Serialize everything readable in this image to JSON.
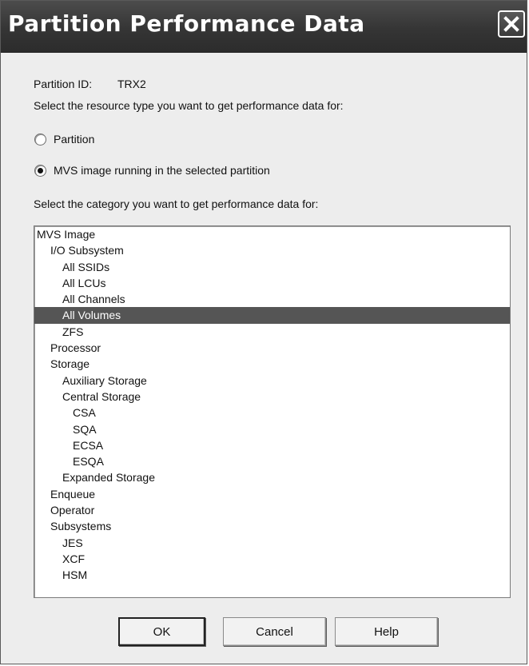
{
  "window": {
    "title": "Partition Performance Data",
    "close_icon": "close-icon"
  },
  "partition": {
    "label": "Partition ID:",
    "value": "TRX2"
  },
  "resource_prompt": "Select the resource type you want to get performance data for:",
  "resource_options": [
    {
      "label": "Partition",
      "checked": false
    },
    {
      "label": "MVS image running in the selected partition",
      "checked": true
    }
  ],
  "category_prompt": "Select the category you want to get performance data for:",
  "tree": {
    "items": [
      {
        "label": "MVS Image",
        "level": 0,
        "selected": false
      },
      {
        "label": "I/O Subsystem",
        "level": 1,
        "selected": false
      },
      {
        "label": "All SSIDs",
        "level": 2,
        "selected": false
      },
      {
        "label": "All LCUs",
        "level": 2,
        "selected": false
      },
      {
        "label": "All Channels",
        "level": 2,
        "selected": false
      },
      {
        "label": "All Volumes",
        "level": 2,
        "selected": true
      },
      {
        "label": "ZFS",
        "level": 2,
        "selected": false
      },
      {
        "label": "Processor",
        "level": 1,
        "selected": false
      },
      {
        "label": "Storage",
        "level": 1,
        "selected": false
      },
      {
        "label": "Auxiliary Storage",
        "level": 2,
        "selected": false
      },
      {
        "label": "Central Storage",
        "level": 2,
        "selected": false
      },
      {
        "label": "CSA",
        "level": 3,
        "selected": false
      },
      {
        "label": "SQA",
        "level": 3,
        "selected": false
      },
      {
        "label": "ECSA",
        "level": 3,
        "selected": false
      },
      {
        "label": "ESQA",
        "level": 3,
        "selected": false
      },
      {
        "label": "Expanded Storage",
        "level": 2,
        "selected": false
      },
      {
        "label": "Enqueue",
        "level": 1,
        "selected": false
      },
      {
        "label": "Operator",
        "level": 1,
        "selected": false
      },
      {
        "label": "Subsystems",
        "level": 1,
        "selected": false
      },
      {
        "label": "JES",
        "level": 2,
        "selected": false
      },
      {
        "label": "XCF",
        "level": 2,
        "selected": false
      },
      {
        "label": "HSM",
        "level": 2,
        "selected": false
      }
    ]
  },
  "buttons": {
    "ok": "OK",
    "cancel": "Cancel",
    "help": "Help"
  }
}
